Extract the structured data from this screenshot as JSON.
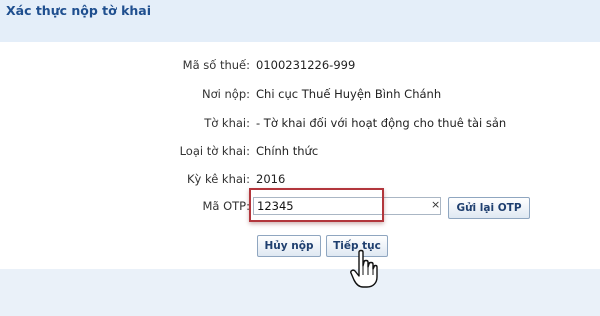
{
  "header": {
    "title": "Xác thực nộp tờ khai"
  },
  "form": {
    "fields": [
      {
        "label": "Mã số thuế:",
        "value": "0100231226-999"
      },
      {
        "label": "Nơi nộp:",
        "value": "Chi cục Thuế Huyện Bình Chánh"
      },
      {
        "label": "Tờ khai:",
        "value": " - Tờ khai đối với hoạt động cho thuê tài sản"
      },
      {
        "label": "Loại tờ khai:",
        "value": "Chính thức"
      },
      {
        "label": "Kỳ kê khai:",
        "value": "2016"
      }
    ],
    "otp": {
      "label": "Mã OTP:",
      "value": "12345",
      "clear_icon": "×",
      "resend_label": "Gửi lại OTP"
    }
  },
  "actions": {
    "cancel_label": "Hủy nộp",
    "continue_label": "Tiếp tục"
  },
  "colors": {
    "header_text": "#1f4f8f",
    "highlight_border": "#b2363c",
    "page_background": "#eaf1f9"
  }
}
